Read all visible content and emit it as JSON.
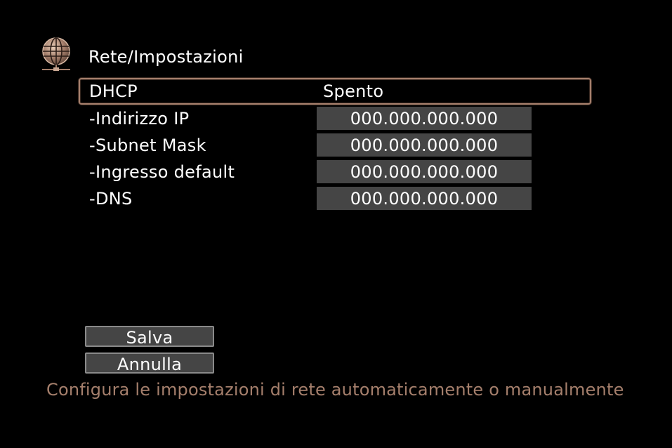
{
  "header": {
    "icon": "globe-network-icon",
    "title": "Rete/Impostazioni"
  },
  "settings": {
    "dhcp": {
      "label": "DHCP",
      "value": "Spento"
    },
    "rows": [
      {
        "label": "-Indirizzo IP",
        "value": "000.000.000.000"
      },
      {
        "label": "-Subnet Mask",
        "value": "000.000.000.000"
      },
      {
        "label": "-Ingresso default",
        "value": "000.000.000.000"
      },
      {
        "label": "-DNS",
        "value": "000.000.000.000"
      }
    ]
  },
  "buttons": {
    "save_label": "Salva",
    "cancel_label": "Annulla"
  },
  "help_text": "Configura le impostazioni di rete automaticamente o manualmente",
  "colors": {
    "background": "#000000",
    "accent": "#a57f6c",
    "field": "#454545",
    "text": "#ffffff"
  }
}
